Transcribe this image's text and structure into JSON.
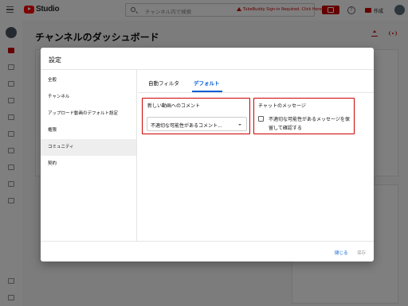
{
  "app": {
    "logo_text": "Studio",
    "search_placeholder": "チャンネル内で検索",
    "alert_text": "TubeBuddy Sign-in Required. Click Here",
    "create_label": "作成",
    "help_label": "?"
  },
  "page": {
    "title": "チャンネルのダッシュボード"
  },
  "dialog": {
    "title": "設定",
    "sidebar": [
      {
        "label": "全般"
      },
      {
        "label": "チャンネル"
      },
      {
        "label": "アップロード動画のデフォルト設定"
      },
      {
        "label": "権限"
      },
      {
        "label": "コミュニティ"
      },
      {
        "label": "契約"
      }
    ],
    "tabs": [
      {
        "label": "自動フィルタ"
      },
      {
        "label": "デフォルト"
      }
    ],
    "comments": {
      "label": "新しい動画へのコメント",
      "dropdown_value": "不適切な可能性があるコメント..."
    },
    "chat": {
      "label": "チャットのメッセージ",
      "checkbox_label": "不適切な可能性があるメッセージを保留して確認する"
    },
    "buttons": {
      "close": "閉じる",
      "save": "保存"
    }
  },
  "colors": {
    "accent": "#065fd4",
    "brand": "#ff0000",
    "highlight": "#cc0000"
  }
}
